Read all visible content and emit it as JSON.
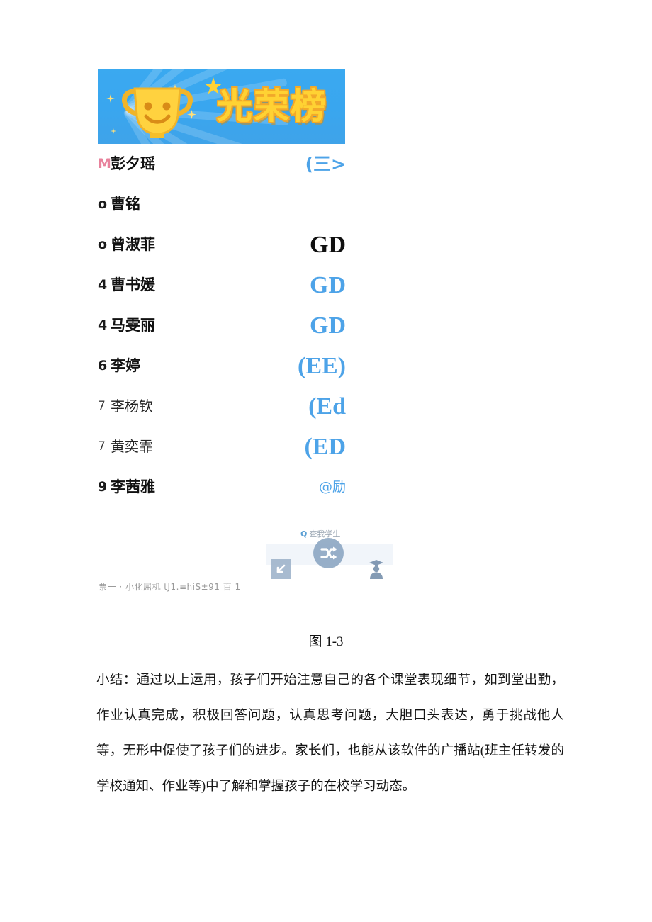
{
  "banner": {
    "title": "光荣榜",
    "background_color": "#3aa9f0",
    "text_color": "#ffd233",
    "trophy_icon": "trophy-icon"
  },
  "ranking": {
    "rows": [
      {
        "rank": "M",
        "name": "彭夕瑶",
        "badge": "(三>",
        "badge_style": "blue-sans",
        "rank_style": "medal"
      },
      {
        "rank": "o",
        "name": "曹铭",
        "badge": "",
        "badge_style": "none",
        "rank_style": "bold"
      },
      {
        "rank": "o",
        "name": "曾淑菲",
        "badge": "GD",
        "badge_style": "dark",
        "rank_style": "bold"
      },
      {
        "rank": "4",
        "name": "曹书媛",
        "badge": "GD",
        "badge_style": "blue",
        "rank_style": "bold"
      },
      {
        "rank": "4",
        "name": "马雯丽",
        "badge": "GD",
        "badge_style": "blue",
        "rank_style": "bold"
      },
      {
        "rank": "6",
        "name": "李婷",
        "badge": "(EE)",
        "badge_style": "blue",
        "rank_style": "bold"
      },
      {
        "rank": "7",
        "name": "李杨钦",
        "badge": "(Ed",
        "badge_style": "blue",
        "rank_style": "light"
      },
      {
        "rank": "7",
        "name": "黄奕霏",
        "badge": "(ED",
        "badge_style": "blue",
        "rank_style": "light"
      },
      {
        "rank": "9",
        "name": "李茜雅",
        "badge": "@励",
        "badge_style": "blue-tiny",
        "rank_style": "bold"
      }
    ]
  },
  "toolbar": {
    "search_icon": "Q",
    "search_label": "查我学生",
    "center_button_icon": "shuffle-icon",
    "left_button_icon": "arrow-down-left-icon",
    "right_icon": "graduate-student-icon"
  },
  "ocr_noise": {
    "text": "票一 · 小化屈机 tJ1.≡hiS±91 百 1"
  },
  "figure": {
    "caption": "图 1-3"
  },
  "document": {
    "summary": "小结：通过以上运用，孩子们开始注意自己的各个课堂表现细节，如到堂出勤，作业认真完成，积极回答问题，认真思考问题，大胆口头表达，勇于挑战他人等，无形中促使了孩子们的进步。家长们，也能从该软件的广播站(班主任转发的学校通知、作业等)中了解和掌握孩子的在校学习动态。"
  }
}
